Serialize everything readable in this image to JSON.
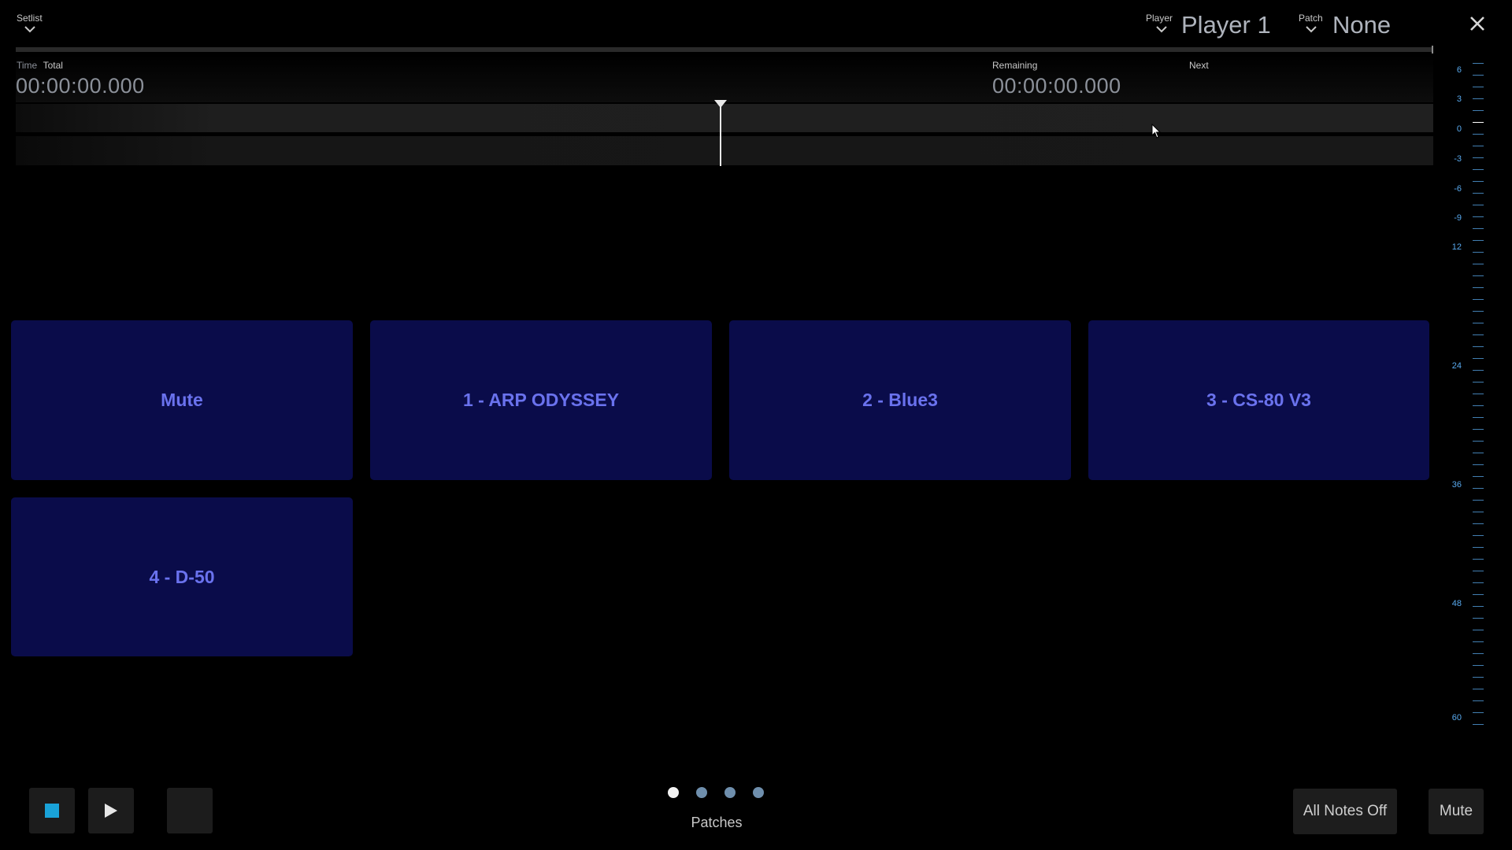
{
  "header": {
    "setlist_label": "Setlist",
    "player_label": "Player",
    "player_value": "Player 1",
    "patch_label": "Patch",
    "patch_value": "None"
  },
  "time": {
    "time_label": "Time",
    "total_label": "Total",
    "total_value": "00:00:00.000",
    "remaining_label": "Remaining",
    "remaining_value": "00:00:00.000",
    "next_label": "Next"
  },
  "patches": [
    {
      "label": "Mute"
    },
    {
      "label": "1 - ARP ODYSSEY"
    },
    {
      "label": "2 - Blue3"
    },
    {
      "label": "3 - CS-80 V3"
    },
    {
      "label": "4 - D-50"
    }
  ],
  "pager": {
    "label": "Patches",
    "active_index": 0,
    "count": 4
  },
  "meter": {
    "labels": [
      "6",
      "3",
      "0",
      "-3",
      "-6",
      "-9",
      "12",
      "24",
      "36",
      "48",
      "60"
    ]
  },
  "controls": {
    "all_notes_off_label": "All Notes Off",
    "mute_label": "Mute"
  },
  "colors": {
    "patch_bg": "#0a0c4a",
    "patch_text": "#6a72ee",
    "stop_accent": "#19a2d8",
    "meter_accent": "#58a9ee"
  }
}
